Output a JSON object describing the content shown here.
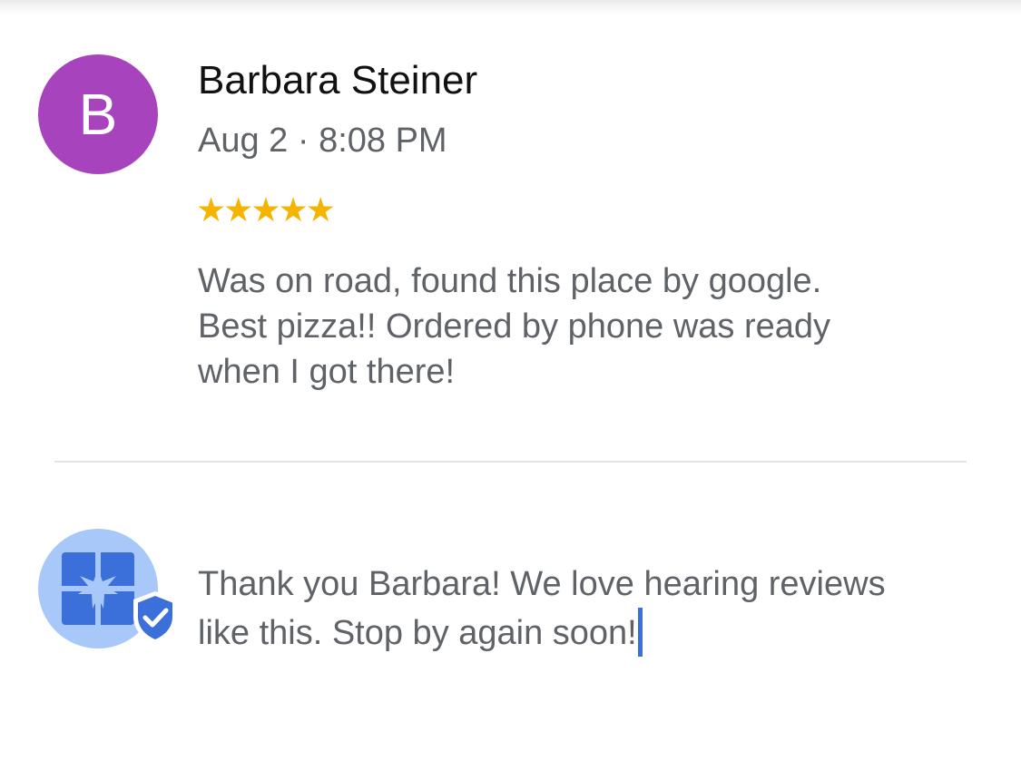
{
  "review": {
    "avatar_initial": "B",
    "avatar_color": "#a744bd",
    "reviewer_name": "Barbara Steiner",
    "date": "Aug 2 · 8:08 PM",
    "rating": 5,
    "stars_text": "★★★★★",
    "star_color": "#f4b400",
    "text": "Was on road, found this place by google. Best pizza!! Ordered by phone was ready when I got there!"
  },
  "reply": {
    "avatar_icon": "business-storefront-icon",
    "badge_icon": "verified-shield-icon",
    "text": "Thank you Barbara! We love hearing reviews like this. Stop by again soon!"
  },
  "colors": {
    "accent": "#3b6fd9",
    "text_secondary": "#5f6368",
    "divider": "#e3e3e3"
  }
}
